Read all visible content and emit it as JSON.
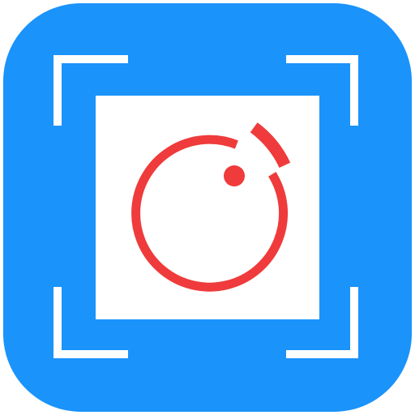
{
  "app_icon": {
    "icon_name": "screenshot-capture-app-icon",
    "colors": {
      "background": "#1a93fb",
      "frame": "#ffffff",
      "card": "#ffffff",
      "lens": "#ef3b3b"
    },
    "elements": {
      "viewfinder_corners": "viewfinder-corners-icon",
      "capture_card": "capture-card",
      "lens_ring": "lens-ring-icon",
      "lens_dot": "lens-dot-icon",
      "flash_arc": "flash-arc-icon"
    }
  }
}
